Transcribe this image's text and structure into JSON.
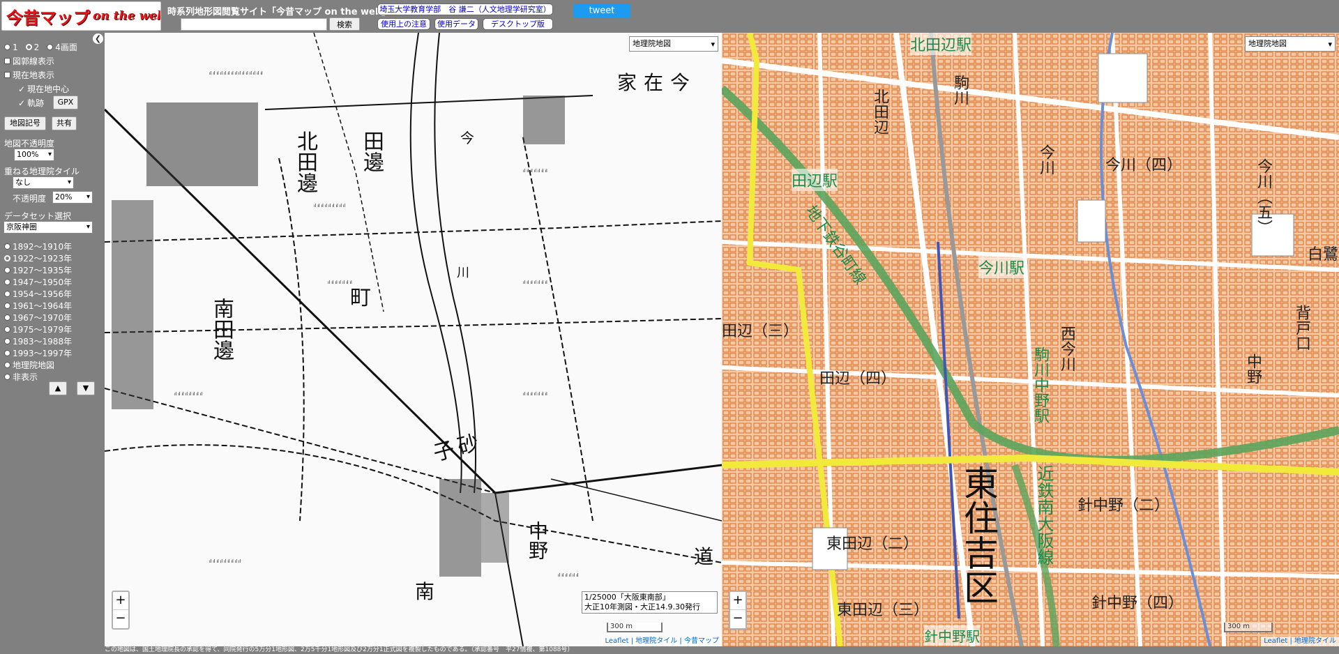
{
  "header": {
    "logo_main": "今昔マップ",
    "logo_sub": "on the web",
    "site_title": "時系列地形図閲覧サイト「今昔マップ on the web」",
    "search_placeholder": "",
    "search_button": "検索",
    "author_link": "埼玉大学教育学部　谷 謙二（人文地理学研究室）",
    "notice_link": "使用上の注意",
    "data_link": "使用データ",
    "desktop_link": "デスクトップ版",
    "tweet": "tweet"
  },
  "sidebar": {
    "screens": [
      "1",
      "2",
      "4画面"
    ],
    "selected_screen": "2",
    "grid_lines": "図郭線表示",
    "show_current": "現在地表示",
    "center_current": "現在地中心",
    "track": "軌跡",
    "gpx": "GPX",
    "map_symbols": "地図記号",
    "share": "共有",
    "opacity_label": "地図不透明度",
    "opacity_value": "100%",
    "overlay_label": "重ねる地理院タイル",
    "overlay_value": "なし",
    "overlay_opacity_label": "不透明度",
    "overlay_opacity_value": "20%",
    "dataset_label": "データセット選択",
    "dataset_value": "京阪神圏",
    "periods": [
      "1892～1910年",
      "1922～1923年",
      "1927～1935年",
      "1947～1950年",
      "1954～1956年",
      "1961～1964年",
      "1967～1970年",
      "1975～1979年",
      "1983～1988年",
      "1993～1997年",
      "地理院地図",
      "非表示"
    ],
    "selected_period": "1922～1923年",
    "up_arrow": "▲",
    "down_arrow": "▼"
  },
  "left_map": {
    "layer_select": "地理院地図",
    "zoom_in": "+",
    "zoom_out": "−",
    "caption_line1": "1/25000「大阪東南部」",
    "caption_line2": "大正10年測図・大正14.9.30発行",
    "scale": "300 m",
    "attribution": "Leaflet | 地理院タイル | 今昔マップ",
    "labels": [
      "家在今",
      "北田邊",
      "田邊",
      "町",
      "南田邊",
      "子砂",
      "中野",
      "南",
      "道",
      "今",
      "川"
    ]
  },
  "right_map": {
    "layer_select": "地理院地図",
    "zoom_in": "+",
    "zoom_out": "−",
    "scale": "300 m",
    "attribution": "Leaflet | 地理院タイル",
    "labels": [
      "北田辺駅",
      "駒川",
      "北田辺",
      "今川",
      "今川（四）",
      "田辺駅",
      "地下鉄谷町線",
      "今川駅",
      "西今川",
      "駒川中野駅",
      "田辺（四）",
      "東住吉区",
      "近鉄南大阪線",
      "針中野（二）",
      "東田辺（二）",
      "東田辺（三）",
      "針中野（四）",
      "中野",
      "背戸口",
      "白鷺",
      "田辺（三）",
      "今川（五）",
      "針中野駅"
    ]
  },
  "footer": {
    "note": "この地図は、国土地理院長の承認を得て、同院発行の5万分1地形図、2万5千分1地形図及び2万分1正式図を複製したものである。（承認番号　平27情複、第1088号）"
  }
}
